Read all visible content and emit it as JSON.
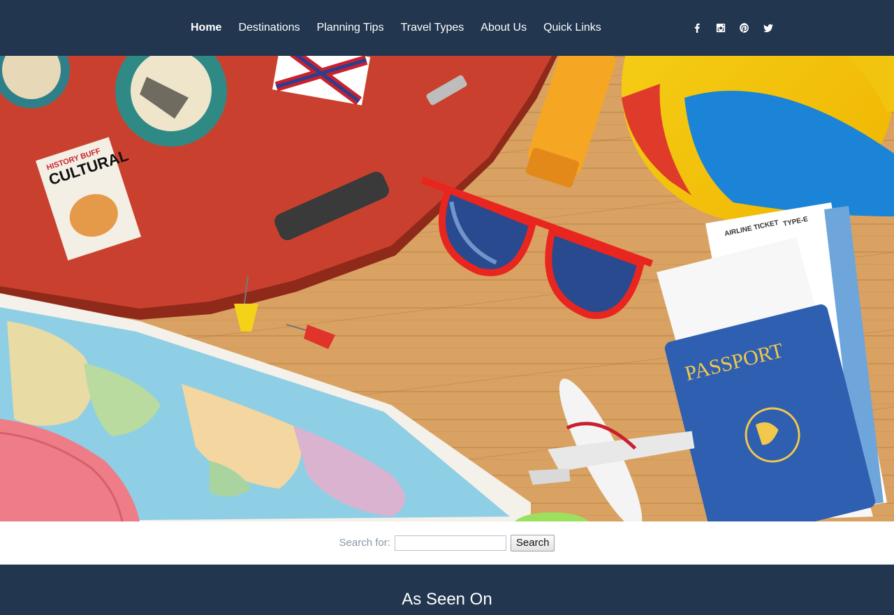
{
  "nav": {
    "items": [
      "Home",
      "Destinations",
      "Planning Tips",
      "Travel Types",
      "About Us",
      "Quick Links"
    ],
    "active": "Home"
  },
  "social": [
    "facebook-icon",
    "instagram-icon",
    "pinterest-icon",
    "twitter-icon"
  ],
  "hero": {
    "sticker_text_1": "CULTURAL",
    "sticker_text_2": "HISTORY BUFF",
    "ticket_text": "AIRLINE TICKET",
    "ticket_type": "TYPE-E",
    "passport_text": "PASSPORT"
  },
  "search": {
    "label": "Search for:",
    "value": "",
    "button": "Search"
  },
  "seen": {
    "title": "As Seen On"
  },
  "colors": {
    "header_bg": "#22364f",
    "footer_bg": "#22364f",
    "wood": "#d8a263",
    "suitcase": "#c9412e",
    "passport": "#2f5fb1"
  }
}
